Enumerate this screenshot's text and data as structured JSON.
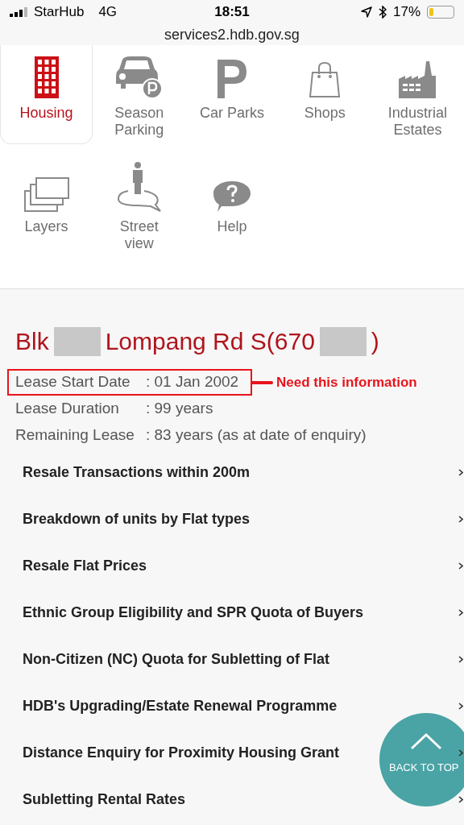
{
  "status_bar": {
    "carrier": "StarHub",
    "network": "4G",
    "time": "18:51",
    "battery": "17%"
  },
  "url": "services2.hdb.gov.sg",
  "tools": [
    {
      "label": "Housing",
      "selected": true
    },
    {
      "label": "Season Parking",
      "selected": false
    },
    {
      "label": "Car Parks",
      "selected": false
    },
    {
      "label": "Shops",
      "selected": false
    },
    {
      "label": "Industrial Estates",
      "selected": false
    },
    {
      "label": "Layers",
      "selected": false
    },
    {
      "label": "Street view",
      "selected": false
    },
    {
      "label": "Help",
      "selected": false
    }
  ],
  "title_parts": [
    {
      "kind": "text",
      "text": "Blk"
    },
    {
      "kind": "redacted"
    },
    {
      "kind": "text",
      "text": "Lompang Rd S(670"
    },
    {
      "kind": "redacted"
    },
    {
      "kind": "text",
      "text": ")"
    }
  ],
  "info_rows": [
    {
      "label": "Lease Start Date",
      "value": ": 01 Jan 2002",
      "highlighted": true
    },
    {
      "label": "Lease Duration",
      "value": ": 99 years",
      "highlighted": false
    },
    {
      "label": "Remaining Lease",
      "value": ": 83 years (as at date of enquiry)",
      "highlighted": false
    }
  ],
  "annotation": "Need this information",
  "links": [
    "Resale Transactions within 200m",
    "Breakdown of units by Flat types",
    "Resale Flat Prices",
    "Ethnic Group Eligibility and SPR Quota of Buyers",
    "Non-Citizen (NC) Quota for Subletting of Flat",
    "HDB's Upgrading/Estate Renewal Programme",
    "Distance Enquiry for Proximity Housing Grant",
    "Subletting Rental Rates"
  ],
  "back_to_top": "BACK TO TOP"
}
